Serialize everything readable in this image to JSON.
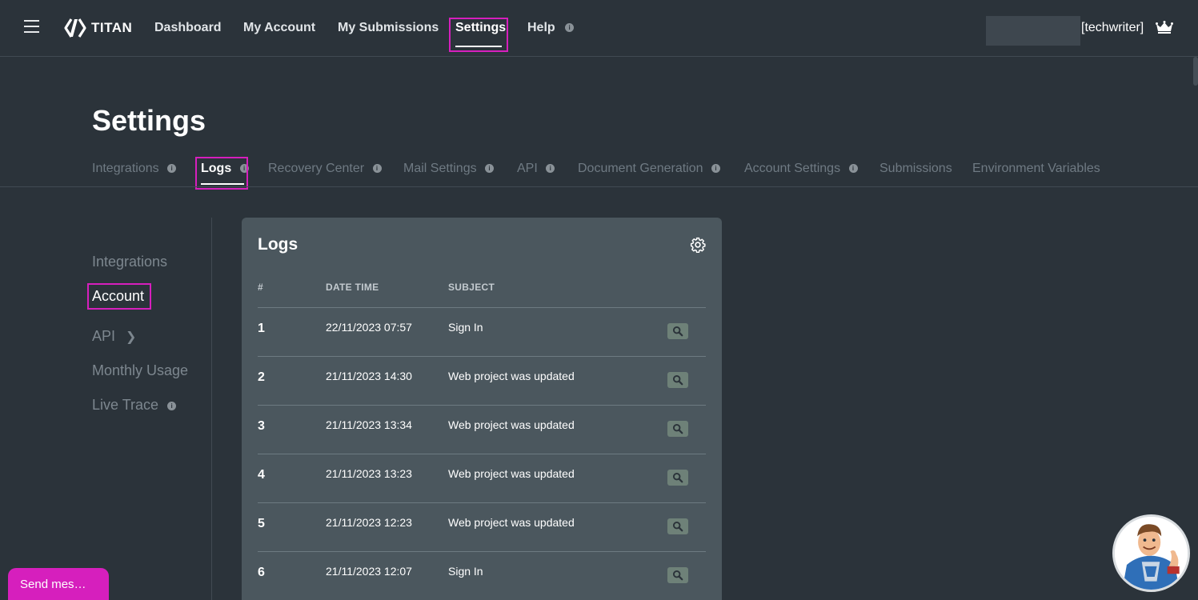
{
  "brand": {
    "name": "TITAN"
  },
  "nav": {
    "items": [
      {
        "label": "Dashboard"
      },
      {
        "label": "My Account"
      },
      {
        "label": "My Submissions"
      },
      {
        "label": "Settings"
      },
      {
        "label": "Help"
      }
    ],
    "active": "Settings",
    "info_badge": "i"
  },
  "user": {
    "name": "[techwriter]"
  },
  "page": {
    "title": "Settings"
  },
  "tabs": [
    {
      "label": "Integrations"
    },
    {
      "label": "Logs"
    },
    {
      "label": "Recovery Center"
    },
    {
      "label": "Mail Settings"
    },
    {
      "label": "API"
    },
    {
      "label": "Document Generation"
    },
    {
      "label": "Account Settings"
    },
    {
      "label": "Submissions"
    },
    {
      "label": "Environment Variables"
    }
  ],
  "side_menu": [
    {
      "label": "Integrations"
    },
    {
      "label": "Account"
    },
    {
      "label": "API"
    },
    {
      "label": "Monthly Usage"
    },
    {
      "label": "Live Trace"
    }
  ],
  "logs": {
    "title": "Logs",
    "columns": [
      "#",
      "DATE TIME",
      "SUBJECT"
    ],
    "rows": [
      {
        "num": "1",
        "datetime": "22/11/2023 07:57",
        "subject": "Sign In"
      },
      {
        "num": "2",
        "datetime": "21/11/2023 14:30",
        "subject": "Web project was updated"
      },
      {
        "num": "3",
        "datetime": "21/11/2023 13:34",
        "subject": "Web project was updated"
      },
      {
        "num": "4",
        "datetime": "21/11/2023 13:23",
        "subject": "Web project was updated"
      },
      {
        "num": "5",
        "datetime": "21/11/2023 12:23",
        "subject": "Web project was updated"
      },
      {
        "num": "6",
        "datetime": "21/11/2023 12:07",
        "subject": "Sign In"
      }
    ]
  },
  "chat": {
    "send_label": "Send mes…"
  },
  "colors": {
    "background": "#2b333a",
    "card": "#4b575e",
    "highlight": "#d61fbd",
    "view_button": "#6e8178"
  }
}
